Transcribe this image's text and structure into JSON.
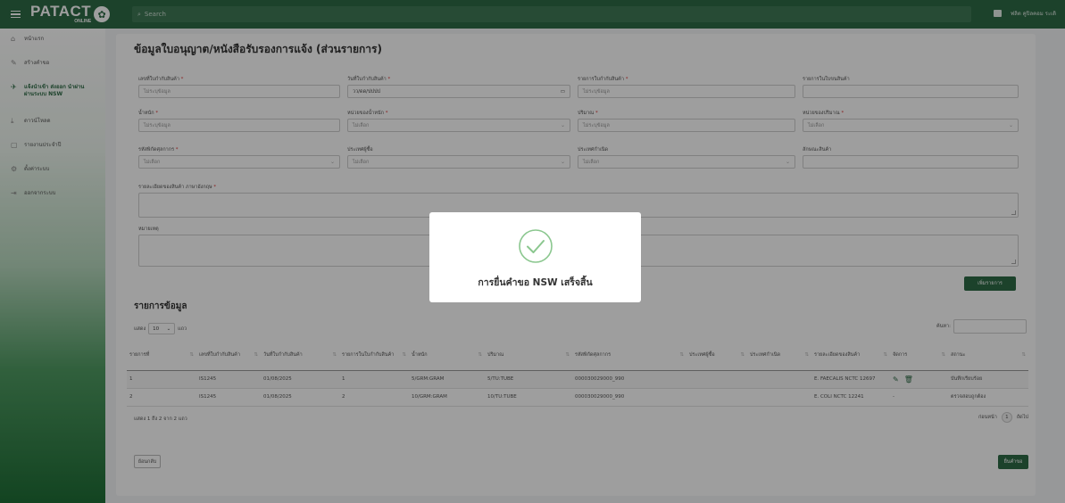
{
  "topbar": {
    "brand_name": "PATACT",
    "brand_sub": "ONLINE",
    "search_placeholder": "Search",
    "user_name": "ฟลิต คูปิลคอม ระเดิ"
  },
  "sidebar": {
    "items": [
      {
        "label": "หน้าแรก",
        "icon": "home-icon",
        "glyph": "⌂"
      },
      {
        "label": "สร้างคำขอ",
        "icon": "pencil-icon",
        "glyph": "✎"
      },
      {
        "label": "แจ้งนำเข้า ส่งออก นำผ่าน ผ่านระบบ NSW",
        "icon": "plane-icon",
        "glyph": "✈"
      },
      {
        "label": "ดาวน์โหลด",
        "icon": "download-icon",
        "glyph": "⤓"
      },
      {
        "label": "รายงานประจำปี",
        "icon": "document-icon",
        "glyph": "▢"
      },
      {
        "label": "ตั้งค่าระบบ",
        "icon": "gears-icon",
        "glyph": "⚙"
      },
      {
        "label": "ออกจากระบบ",
        "icon": "logout-icon",
        "glyph": "⇥"
      }
    ]
  },
  "page": {
    "title": "ข้อมูลใบอนุญาต/หนังสือรับรองการแจ้ง (ส่วนรายการ)"
  },
  "form": {
    "permit_no": {
      "label": "เลขที่ใบกำกับสินค้า",
      "placeholder": "ไม่ระบุข้อมูล"
    },
    "permit_date": {
      "label": "วันที่ใบกำกับสินค้า",
      "value": "วว/ดด/ปปปป"
    },
    "invoice_item": {
      "label": "รายการใบกำกับสินค้า",
      "placeholder": "ไม่ระบุข้อมูล"
    },
    "item_list": {
      "label": "รายการในใบขนสินค้า",
      "placeholder": ""
    },
    "weight": {
      "label": "น้ำหนัก",
      "placeholder": "ไม่ระบุข้อมูล"
    },
    "weight_unit": {
      "label": "หน่วยของน้ำหนัก",
      "placeholder": "ไม่เลือก"
    },
    "quantity": {
      "label": "ปริมาณ",
      "placeholder": "ไม่ระบุข้อมูล"
    },
    "quantity_unit": {
      "label": "หน่วยของปริมาณ",
      "placeholder": "ไม่เลือก"
    },
    "tariff_code": {
      "label": "รหัสพิกัดศุลกากร",
      "placeholder": "ไม่เลือก"
    },
    "buyer_country": {
      "label": "ประเทศผู้ซื้อ",
      "placeholder": "ไม่เลือก"
    },
    "origin_country": {
      "label": "ประเทศกำเนิด",
      "placeholder": "ไม่เลือก"
    },
    "goods_character": {
      "label": "ลักษณะสินค้า",
      "placeholder": ""
    },
    "description_en": {
      "label": "รายละเอียดของสินค้า ภาษาอังกฤษ"
    },
    "remark": {
      "label": "หมายเหตุ"
    },
    "add_button": "เพิ่มรายการ"
  },
  "list": {
    "title": "รายการข้อมูล",
    "show_prefix": "แสดง",
    "page_size": "10",
    "show_suffix": "แถว",
    "search_label": "ค้นหา:",
    "columns": [
      "รายการที่",
      "เลขที่ใบกำกับสินค้า",
      "วันที่ใบกำกับสินค้า",
      "รายการในใบกำกับสินค้า",
      "น้ำหนัก",
      "ปริมาณ",
      "รหัสพิกัดศุลกากร",
      "ประเทศผู้ซื้อ",
      "ประเทศกำเนิด",
      "รายละเอียดของสินค้า",
      "จัดการ",
      "สถานะ"
    ],
    "rows": [
      {
        "no": "1",
        "invoice": "IS1245",
        "date": "01/08/2025",
        "item": "1",
        "weight": "5/GRM:GRAM",
        "qty": "5/TU:TUBE",
        "tariff": "000030029000_990",
        "buyer": "",
        "origin": "",
        "desc": "E. FAECALIS NCTC 12697",
        "status": "บันทึกเรียบร้อย"
      },
      {
        "no": "2",
        "invoice": "IS1245",
        "date": "01/08/2025",
        "item": "2",
        "weight": "10/GRM:GRAM",
        "qty": "10/TU:TUBE",
        "tariff": "000030029000_990",
        "buyer": "",
        "origin": "",
        "desc": "E. COLI NCTC 12241",
        "manage": "-",
        "status": "ตรวจสอบถูกต้อง"
      }
    ],
    "info": "แสดง 1 ถึง 2 จาก 2 แถว",
    "prev": "ก่อนหน้า",
    "page": "1",
    "next": "ถัดไป"
  },
  "actions": {
    "back": "ย้อนกลับ",
    "submit": "ยื่นคำขอ"
  },
  "modal": {
    "message": "การยื่นคำขอ NSW เสร็จสิ้น",
    "icon": "check-circle-icon",
    "color": "#8bc78f"
  },
  "colors": {
    "primary": "#2e6b46"
  }
}
